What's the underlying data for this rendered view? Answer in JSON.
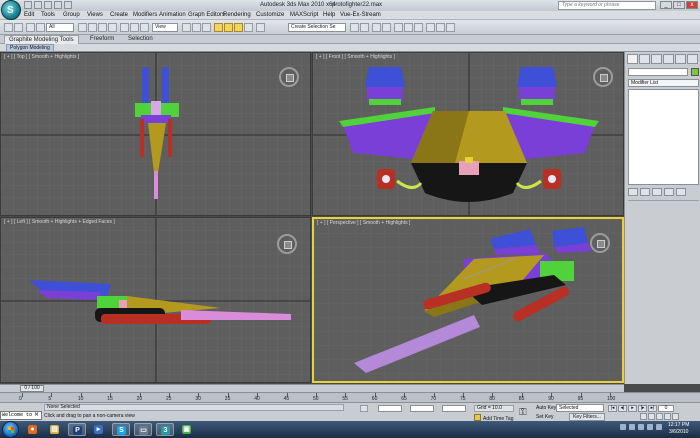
{
  "window": {
    "app_title": "Autodesk 3ds Max  2010 x64",
    "file_name": "protofighter22.max",
    "search_placeholder": "Type a keyword or phrase",
    "min_label": "_",
    "max_label": "□",
    "close_label": "x",
    "logo_letter": "S"
  },
  "menu": [
    "Edit",
    "Tools",
    "Group",
    "Views",
    "Create",
    "Modifiers",
    "Animation",
    "Graph Editors",
    "Rendering",
    "Customize",
    "MAXScript",
    "Help",
    "Vue-Ex-Stream"
  ],
  "toolbar": {
    "selection_filter": "All",
    "ref_coord": "View",
    "named_selection": "Create Selection Se"
  },
  "ribbon": {
    "tabs": [
      "Graphite Modeling Tools",
      "Freeform",
      "Selection"
    ],
    "active_tab": 0,
    "panel_label": "Polygon Modeling"
  },
  "viewports": {
    "top": "[ + ] [ Top ] [ Smooth + Highlights ]",
    "front": "[ + ] [ Front ] [ Smooth + Highlights ]",
    "left": "[ + ] [ Left ] [ Smooth + Highlights + Edged Faces ]",
    "perspective": "[ + ] [ Perspective ] [ Smooth + Highlights ]"
  },
  "command_panel": {
    "modifier_list": "Modifier List",
    "object_color": "#7dc83a"
  },
  "timeline": {
    "slider_label": "0 / 100",
    "ticks": [
      "0",
      "5",
      "10",
      "15",
      "20",
      "25",
      "30",
      "35",
      "40",
      "45",
      "50",
      "55",
      "60",
      "65",
      "70",
      "75",
      "80",
      "85",
      "90",
      "95",
      "100"
    ]
  },
  "status": {
    "listener": "Welcome to M",
    "selection": "None Selected",
    "prompt": "Click and drag to pan a non-camera view",
    "grid": "Grid = 10.0",
    "add_time_tag": "Add Time Tag",
    "auto_key": "Auto Key",
    "set_key": "Set Key",
    "selected_dropdown": "Selected",
    "key_filters": "Key Filters...",
    "frame": "0"
  },
  "taskbar": {
    "time": "12:17 PM",
    "date": "3/6/2010"
  },
  "colors": {
    "viewport_bg": "#5e5e5e",
    "active_viewport_border": "#e8d23a",
    "purple": "#7a3fd6",
    "blue": "#3e4fd8",
    "green": "#4fd23a",
    "gold": "#b39a1e",
    "red": "#b82f23",
    "pink": "#d98cd9"
  }
}
